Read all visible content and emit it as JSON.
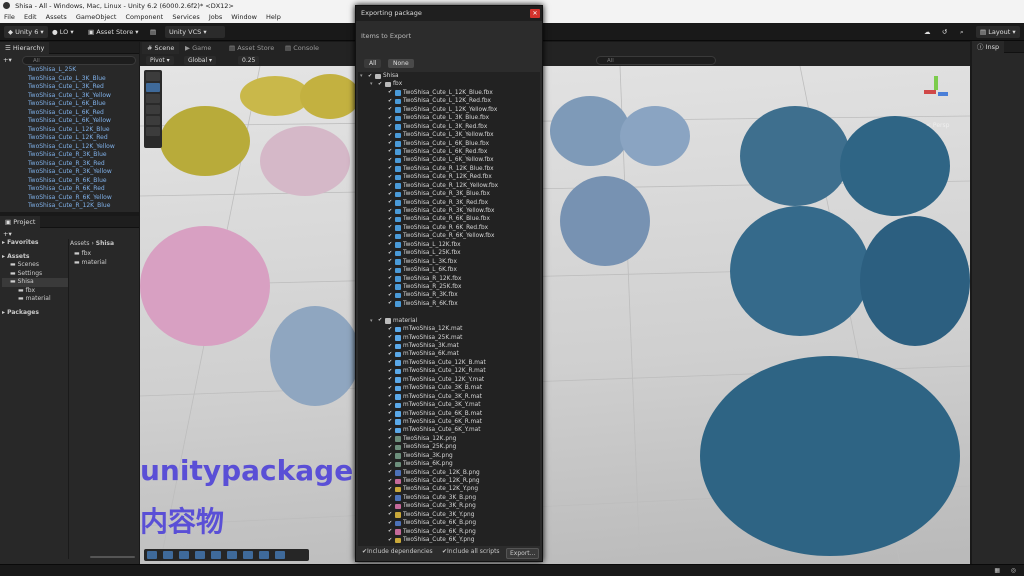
{
  "window": {
    "title": "Shisa - All - Windows, Mac, Linux - Unity 6.2 (6000.2.6f2)* <DX12>"
  },
  "menu": [
    "File",
    "Edit",
    "Assets",
    "GameObject",
    "Component",
    "Services",
    "Jobs",
    "Window",
    "Help"
  ],
  "toolbar": {
    "account": "Unity 6",
    "lo": "LO",
    "asset_store": "Asset Store",
    "vcs": "Unity VCS",
    "layout": "Layout"
  },
  "hierarchy": {
    "tab": "Hierarchy",
    "search_placeholder": "All",
    "items": [
      "TwoShisa_L_25K",
      "TwoShisa_Cute_L_3K_Blue",
      "TwoShisa_Cute_L_3K_Red",
      "TwoShisa_Cute_L_3K_Yellow",
      "TwoShisa_Cute_L_6K_Blue",
      "TwoShisa_Cute_L_6K_Red",
      "TwoShisa_Cute_L_6K_Yellow",
      "TwoShisa_Cute_L_12K_Blue",
      "TwoShisa_Cute_L_12K_Red",
      "TwoShisa_Cute_L_12K_Yellow",
      "TwoShisa_Cute_R_3K_Blue",
      "TwoShisa_Cute_R_3K_Red",
      "TwoShisa_Cute_R_3K_Yellow",
      "TwoShisa_Cute_R_6K_Blue",
      "TwoShisa_Cute_R_6K_Red",
      "TwoShisa_Cute_R_6K_Yellow",
      "TwoShisa_Cute_R_12K_Blue"
    ]
  },
  "project": {
    "tab": "Project",
    "tree": [
      {
        "label": "Favorites",
        "indent": 0,
        "bold": true
      },
      {
        "label": "Assets",
        "indent": 0,
        "bold": true
      },
      {
        "label": "Scenes",
        "indent": 1,
        "bold": false
      },
      {
        "label": "Settings",
        "indent": 1,
        "bold": false
      },
      {
        "label": "Shisa",
        "indent": 1,
        "bold": false
      },
      {
        "label": "fbx",
        "indent": 2,
        "bold": false
      },
      {
        "label": "material",
        "indent": 2,
        "bold": false
      },
      {
        "label": "Packages",
        "indent": 0,
        "bold": true
      }
    ],
    "breadcrumb": [
      "Assets",
      "Shisa"
    ],
    "folders": [
      "fbx",
      "material"
    ]
  },
  "scene_tabs": [
    "Scene",
    "Game",
    "Asset Store",
    "Console"
  ],
  "scene_toolbar": {
    "pivot": "Pivot",
    "global": "Global",
    "snap": "0.25",
    "search_placeholder": "All"
  },
  "gizmo_label": "< Persp",
  "inspector_tab": "Insp",
  "overlay": {
    "line1": "unitypackage",
    "line2": "内容物"
  },
  "dialog": {
    "title": "Exporting package",
    "subtitle": "Items to Export",
    "btn_all": "All",
    "btn_none": "None",
    "tree": [
      {
        "label": "Shisa",
        "kind": "folder",
        "indent": 0,
        "arrow": true
      },
      {
        "label": "fbx",
        "kind": "folder",
        "indent": 1,
        "arrow": true
      },
      {
        "label": "TwoShisa_Cute_L_12K_Blue.fbx",
        "kind": "fbx",
        "indent": 2
      },
      {
        "label": "TwoShisa_Cute_L_12K_Red.fbx",
        "kind": "fbx",
        "indent": 2
      },
      {
        "label": "TwoShisa_Cute_L_12K_Yellow.fbx",
        "kind": "fbx",
        "indent": 2
      },
      {
        "label": "TwoShisa_Cute_L_3K_Blue.fbx",
        "kind": "fbx",
        "indent": 2
      },
      {
        "label": "TwoShisa_Cute_L_3K_Red.fbx",
        "kind": "fbx",
        "indent": 2
      },
      {
        "label": "TwoShisa_Cute_L_3K_Yellow.fbx",
        "kind": "fbx",
        "indent": 2
      },
      {
        "label": "TwoShisa_Cute_L_6K_Blue.fbx",
        "kind": "fbx",
        "indent": 2
      },
      {
        "label": "TwoShisa_Cute_L_6K_Red.fbx",
        "kind": "fbx",
        "indent": 2
      },
      {
        "label": "TwoShisa_Cute_L_6K_Yellow.fbx",
        "kind": "fbx",
        "indent": 2
      },
      {
        "label": "TwoShisa_Cute_R_12K_Blue.fbx",
        "kind": "fbx",
        "indent": 2
      },
      {
        "label": "TwoShisa_Cute_R_12K_Red.fbx",
        "kind": "fbx",
        "indent": 2
      },
      {
        "label": "TwoShisa_Cute_R_12K_Yellow.fbx",
        "kind": "fbx",
        "indent": 2
      },
      {
        "label": "TwoShisa_Cute_R_3K_Blue.fbx",
        "kind": "fbx",
        "indent": 2
      },
      {
        "label": "TwoShisa_Cute_R_3K_Red.fbx",
        "kind": "fbx",
        "indent": 2
      },
      {
        "label": "TwoShisa_Cute_R_3K_Yellow.fbx",
        "kind": "fbx",
        "indent": 2
      },
      {
        "label": "TwoShisa_Cute_R_6K_Blue.fbx",
        "kind": "fbx",
        "indent": 2
      },
      {
        "label": "TwoShisa_Cute_R_6K_Red.fbx",
        "kind": "fbx",
        "indent": 2
      },
      {
        "label": "TwoShisa_Cute_R_6K_Yellow.fbx",
        "kind": "fbx",
        "indent": 2
      },
      {
        "label": "TwoShisa_L_12K.fbx",
        "kind": "fbx",
        "indent": 2
      },
      {
        "label": "TwoShisa_L_25K.fbx",
        "kind": "fbx",
        "indent": 2
      },
      {
        "label": "TwoShisa_L_3K.fbx",
        "kind": "fbx",
        "indent": 2
      },
      {
        "label": "TwoShisa_L_6K.fbx",
        "kind": "fbx",
        "indent": 2
      },
      {
        "label": "TwoShisa_R_12K.fbx",
        "kind": "fbx",
        "indent": 2
      },
      {
        "label": "TwoShisa_R_25K.fbx",
        "kind": "fbx",
        "indent": 2
      },
      {
        "label": "TwoShisa_R_3K.fbx",
        "kind": "fbx",
        "indent": 2
      },
      {
        "label": "TwoShisa_R_6K.fbx",
        "kind": "fbx",
        "indent": 2
      },
      {
        "label": "",
        "kind": "blank",
        "indent": 0
      },
      {
        "label": "material",
        "kind": "folder",
        "indent": 1,
        "arrow": true
      },
      {
        "label": "mTwoShisa_12K.mat",
        "kind": "mat",
        "indent": 2
      },
      {
        "label": "mTwoShisa_25K.mat",
        "kind": "mat",
        "indent": 2
      },
      {
        "label": "mTwoShisa_3K.mat",
        "kind": "mat",
        "indent": 2
      },
      {
        "label": "mTwoShisa_6K.mat",
        "kind": "mat",
        "indent": 2
      },
      {
        "label": "mTwoShisa_Cute_12K_B.mat",
        "kind": "mat",
        "indent": 2
      },
      {
        "label": "mTwoShisa_Cute_12K_R.mat",
        "kind": "mat",
        "indent": 2
      },
      {
        "label": "mTwoShisa_Cute_12K_Y.mat",
        "kind": "mat",
        "indent": 2
      },
      {
        "label": "mTwoShisa_Cute_3K_B.mat",
        "kind": "mat",
        "indent": 2
      },
      {
        "label": "mTwoShisa_Cute_3K_R.mat",
        "kind": "mat",
        "indent": 2
      },
      {
        "label": "mTwoShisa_Cute_3K_Y.mat",
        "kind": "mat",
        "indent": 2
      },
      {
        "label": "mTwoShisa_Cute_6K_B.mat",
        "kind": "mat",
        "indent": 2
      },
      {
        "label": "mTwoShisa_Cute_6K_R.mat",
        "kind": "mat",
        "indent": 2
      },
      {
        "label": "mTwoShisa_Cute_6K_Y.mat",
        "kind": "mat",
        "indent": 2
      },
      {
        "label": "TwoShisa_12K.png",
        "kind": "png",
        "indent": 2
      },
      {
        "label": "TwoShisa_25K.png",
        "kind": "png",
        "indent": 2
      },
      {
        "label": "TwoShisa_3K.png",
        "kind": "png",
        "indent": 2
      },
      {
        "label": "TwoShisa_6K.png",
        "kind": "png",
        "indent": 2
      },
      {
        "label": "TwoShisa_Cute_12K_B.png",
        "kind": "pngb",
        "indent": 2
      },
      {
        "label": "TwoShisa_Cute_12K_R.png",
        "kind": "pngr",
        "indent": 2
      },
      {
        "label": "TwoShisa_Cute_12K_Y.png",
        "kind": "pngy",
        "indent": 2
      },
      {
        "label": "TwoShisa_Cute_3K_B.png",
        "kind": "pngb",
        "indent": 2
      },
      {
        "label": "TwoShisa_Cute_3K_R.png",
        "kind": "pngr",
        "indent": 2
      },
      {
        "label": "TwoShisa_Cute_3K_Y.png",
        "kind": "pngy",
        "indent": 2
      },
      {
        "label": "TwoShisa_Cute_6K_B.png",
        "kind": "pngb",
        "indent": 2
      },
      {
        "label": "TwoShisa_Cute_6K_R.png",
        "kind": "pngr",
        "indent": 2
      },
      {
        "label": "TwoShisa_Cute_6K_Y.png",
        "kind": "pngy",
        "indent": 2
      }
    ],
    "include_dependencies": "Include dependencies",
    "include_scripts": "Include all scripts",
    "export_label": "Export..."
  },
  "colors": {
    "accent_blue": "#4a8fd8",
    "overlay_text": "#5a4fd6",
    "close_red": "#d4322c",
    "fbx_icon": "#4a9ad8",
    "mat_icon": "#5aa8e8",
    "png_icon": "#6d8f7c",
    "pngb_icon": "#4d72b8",
    "pngr_icon": "#c46a9a",
    "pngy_icon": "#c9a83a"
  }
}
